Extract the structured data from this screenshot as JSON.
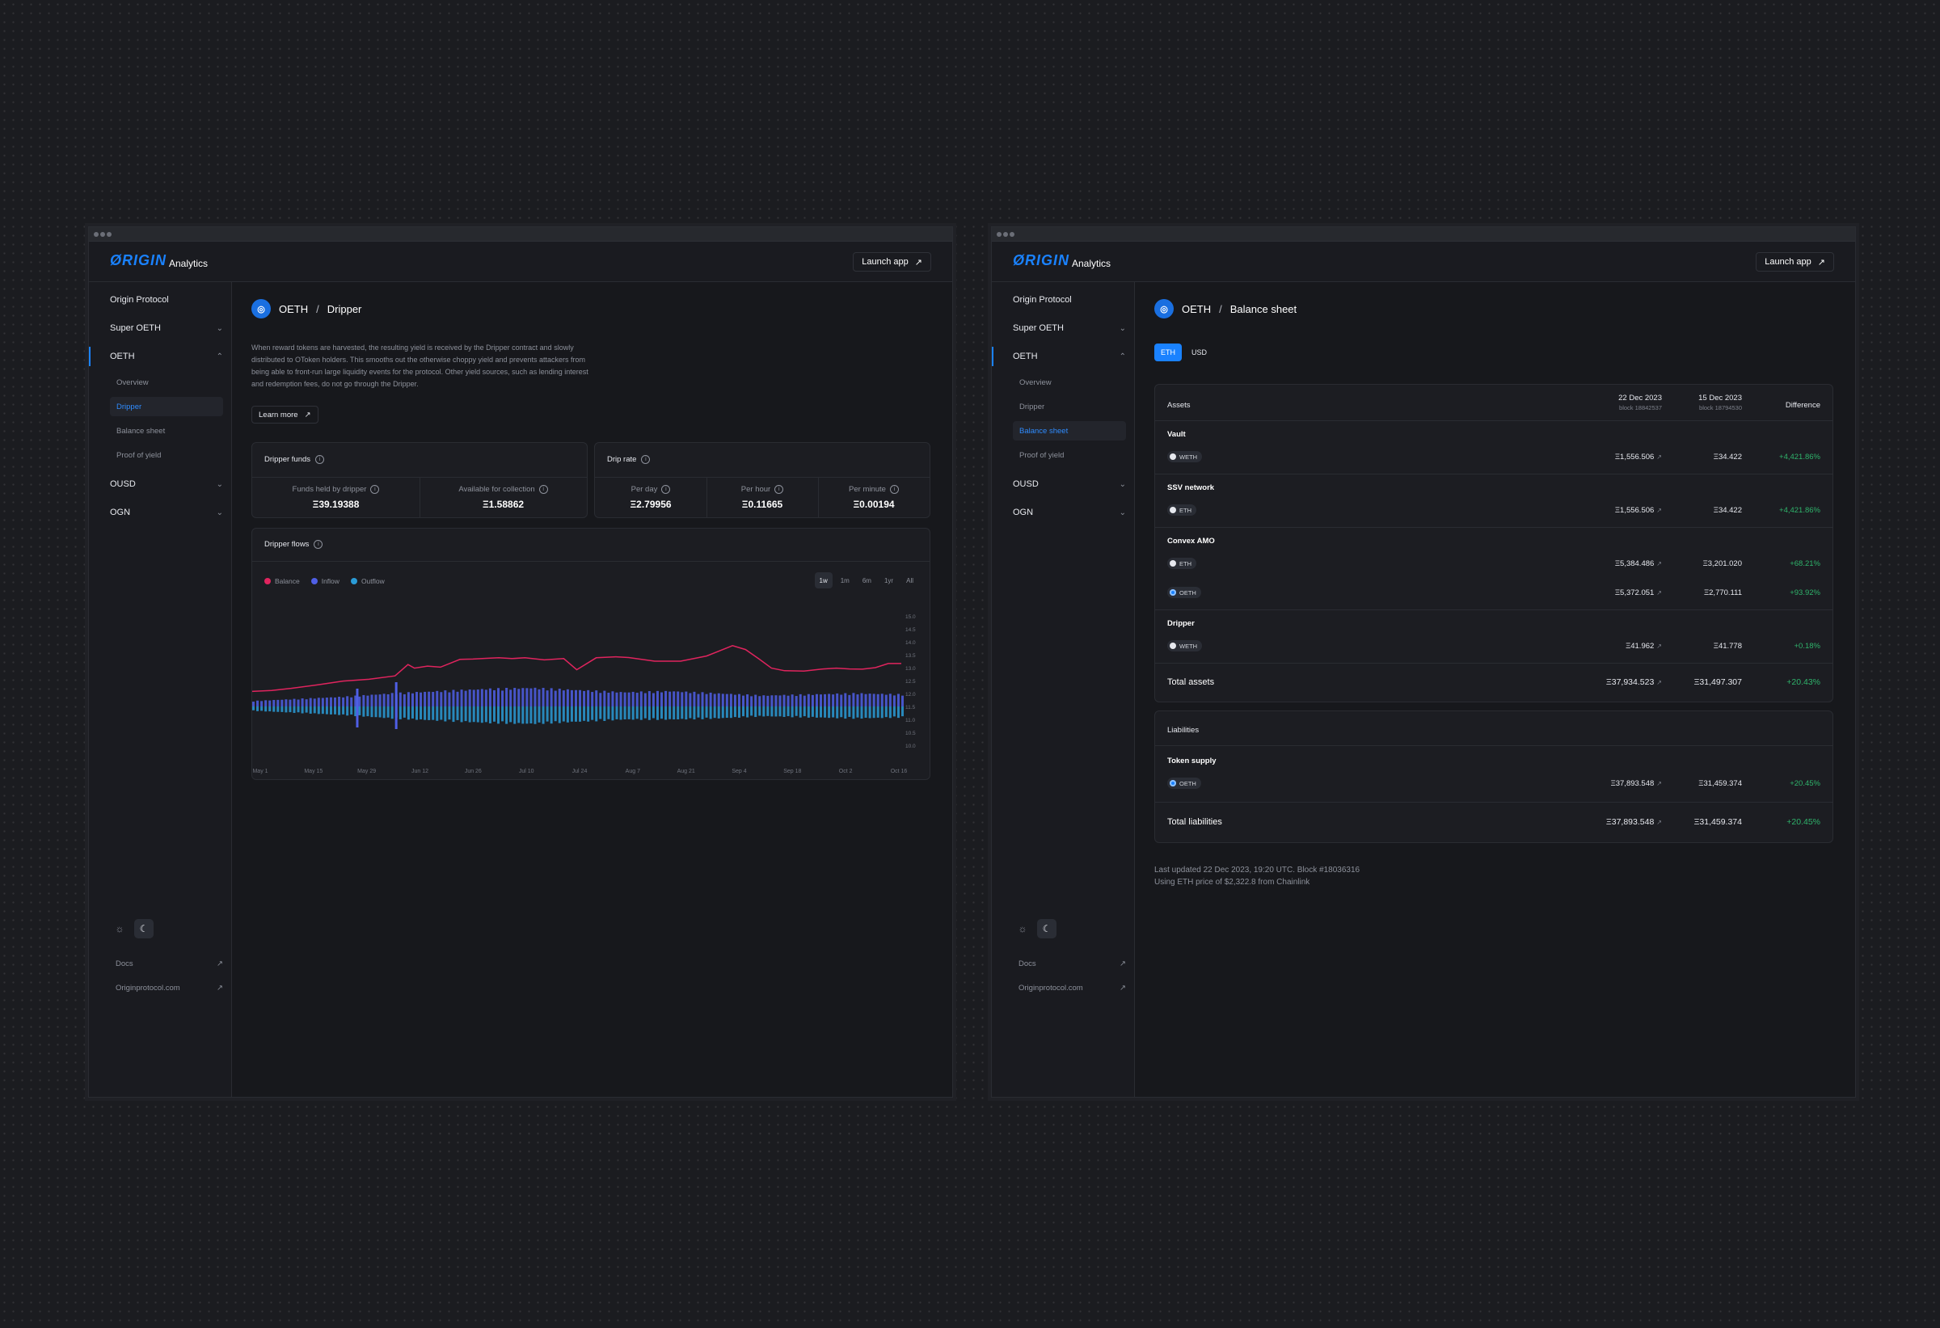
{
  "brand": {
    "logo": "ØRIGIN",
    "product": "Analytics",
    "launch": "Launch app"
  },
  "nav": {
    "origin": "Origin Protocol",
    "super_oeth": "Super OETH",
    "oeth": "OETH",
    "sub": [
      "Overview",
      "Dripper",
      "Balance sheet",
      "Proof of yield"
    ],
    "ousd": "OUSD",
    "ogn": "OGN",
    "docs": "Docs",
    "site": "Originprotocol.com"
  },
  "dripper": {
    "crumb_token": "OETH",
    "crumb_page": "Dripper",
    "description": "When reward tokens are harvested, the resulting yield is received by the Dripper contract and slowly distributed to OToken holders. This smooths out the otherwise choppy yield and prevents attackers from being able to front-run large liquidity events for the protocol. Other yield sources, such as lending interest and redemption fees, do not go through the Dripper.",
    "learn_more": "Learn more",
    "funds": {
      "title": "Dripper funds",
      "held_label": "Funds held by dripper",
      "held_value": "Ξ39.19388",
      "avail_label": "Available for collection",
      "avail_value": "Ξ1.58862"
    },
    "rate": {
      "title": "Drip rate",
      "day_label": "Per day",
      "day_value": "Ξ2.79956",
      "hour_label": "Per hour",
      "hour_value": "Ξ0.11665",
      "min_label": "Per minute",
      "min_value": "Ξ0.00194"
    },
    "flows": {
      "title": "Dripper flows",
      "legend": [
        "Balance",
        "Inflow",
        "Outflow"
      ],
      "ranges": [
        "1w",
        "1m",
        "6m",
        "1yr",
        "All"
      ]
    }
  },
  "chart_data": {
    "type": "line",
    "title": "Dripper flows",
    "x_ticks": [
      "May 1",
      "May 15",
      "May 29",
      "Jun 12",
      "Jun 26",
      "Jul 10",
      "Jul 24",
      "Aug 7",
      "Aug 21",
      "Sep 4",
      "Sep 18",
      "Oct 2",
      "Oct 16"
    ],
    "y_ticks": [
      "15.0",
      "14.5",
      "14.0",
      "13.5",
      "13.0",
      "12.5",
      "12.0",
      "11.5",
      "11.0",
      "10.5",
      "10.0"
    ],
    "ylim": [
      10.0,
      15.0
    ],
    "series": [
      {
        "name": "Balance",
        "color": "#e0245e",
        "x": [
          0,
          0.03,
          0.06,
          0.1,
          0.14,
          0.18,
          0.22,
          0.24,
          0.25,
          0.27,
          0.29,
          0.32,
          0.34,
          0.36,
          0.38,
          0.4,
          0.42,
          0.45,
          0.48,
          0.5,
          0.53,
          0.56,
          0.58,
          0.62,
          0.66,
          0.7,
          0.74,
          0.76,
          0.78,
          0.8,
          0.82,
          0.85,
          0.88,
          0.9,
          0.92,
          0.94,
          0.96,
          0.98,
          1.0
        ],
        "y": [
          12.08,
          12.12,
          12.2,
          12.33,
          12.48,
          12.55,
          12.68,
          13.12,
          12.98,
          13.06,
          13.02,
          13.32,
          13.33,
          13.36,
          13.38,
          13.35,
          13.38,
          13.3,
          13.35,
          12.92,
          13.38,
          13.42,
          13.39,
          13.25,
          13.25,
          13.45,
          13.85,
          13.7,
          13.35,
          12.98,
          12.88,
          12.87,
          12.95,
          12.98,
          12.95,
          12.94,
          13.0,
          13.16,
          13.16
        ]
      },
      {
        "name": "Inflow",
        "color": "#4f5fe6",
        "amplitude": [
          0.25,
          0.35,
          0.45,
          0.6,
          0.7,
          0.8,
          0.85,
          0.75,
          0.65,
          0.7,
          0.6,
          0.5,
          0.55,
          0.6,
          0.55
        ]
      },
      {
        "name": "Outflow",
        "color": "#2a9bd6",
        "amplitude": [
          0.2,
          0.3,
          0.4,
          0.55,
          0.65,
          0.75,
          0.8,
          0.7,
          0.6,
          0.6,
          0.55,
          0.45,
          0.5,
          0.55,
          0.5
        ]
      }
    ],
    "legend": "top-left",
    "grid": false
  },
  "balance": {
    "crumb_token": "OETH",
    "crumb_page": "Balance sheet",
    "currency": [
      "ETH",
      "USD"
    ],
    "assets_label": "Assets",
    "col1_date": "22 Dec 2023",
    "col1_block": "block 18842537",
    "col2_date": "15 Dec 2023",
    "col2_block": "block 18794530",
    "diff_label": "Difference",
    "groups": [
      {
        "name": "Vault",
        "rows": [
          {
            "asset": "WETH",
            "v1": "Ξ1,556.506",
            "v2": "Ξ34.422",
            "diff": "+4,421.86%"
          }
        ]
      },
      {
        "name": "SSV network",
        "rows": [
          {
            "asset": "ETH",
            "v1": "Ξ1,556.506",
            "v2": "Ξ34.422",
            "diff": "+4,421.86%"
          }
        ]
      },
      {
        "name": "Convex AMO",
        "rows": [
          {
            "asset": "ETH",
            "v1": "Ξ5,384.486",
            "v2": "Ξ3,201.020",
            "diff": "+68.21%"
          },
          {
            "asset": "OETH",
            "v1": "Ξ5,372.051",
            "v2": "Ξ2,770.111",
            "diff": "+93.92%"
          }
        ]
      },
      {
        "name": "Dripper",
        "rows": [
          {
            "asset": "WETH",
            "v1": "Ξ41.962",
            "v2": "Ξ41.778",
            "diff": "+0.18%"
          }
        ]
      }
    ],
    "total_assets": {
      "label": "Total assets",
      "v1": "Ξ37,934.523",
      "v2": "Ξ31,497.307",
      "diff": "+20.43%"
    },
    "liabilities_label": "Liabilities",
    "token_supply": {
      "name": "Token supply",
      "asset": "OETH",
      "v1": "Ξ37,893.548",
      "v2": "Ξ31,459.374",
      "diff": "+20.45%"
    },
    "total_liabilities": {
      "label": "Total liabilities",
      "v1": "Ξ37,893.548",
      "v2": "Ξ31,459.374",
      "diff": "+20.45%"
    },
    "note1": "Last updated 22 Dec 2023, 19:20 UTC. Block #18036316",
    "note2": "Using ETH price of $2,322.8 from Chainlink"
  }
}
